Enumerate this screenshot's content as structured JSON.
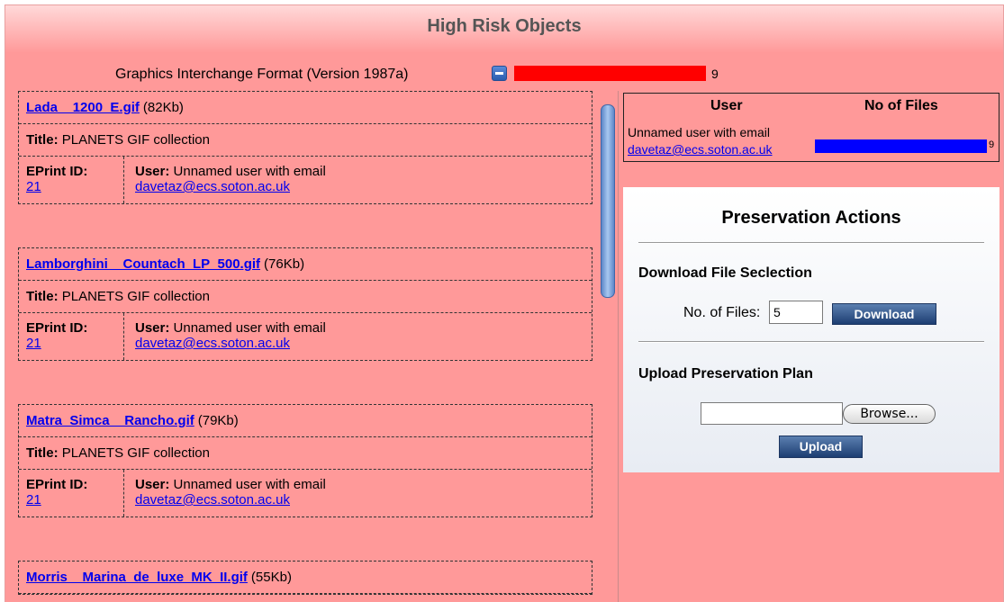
{
  "header": {
    "title": "High Risk Objects"
  },
  "format": {
    "label": "Graphics Interchange Format (Version 1987a)",
    "count": "9",
    "bar_color": "#ff0000"
  },
  "records": [
    {
      "filename": "Lada__1200_E.gif",
      "size": "(82Kb)",
      "title_label": "Title:",
      "title_value": "PLANETS GIF collection",
      "eprint_label": "EPrint ID:",
      "eprint_id": "21",
      "user_label": "User:",
      "user_value": "Unnamed user with email",
      "user_email": "davetaz@ecs.soton.ac.uk"
    },
    {
      "filename": "Lamborghini__Countach_LP_500.gif",
      "size": "(76Kb)",
      "title_label": "Title:",
      "title_value": "PLANETS GIF collection",
      "eprint_label": "EPrint ID:",
      "eprint_id": "21",
      "user_label": "User:",
      "user_value": "Unnamed user with email",
      "user_email": "davetaz@ecs.soton.ac.uk"
    },
    {
      "filename": "Matra_Simca__Rancho.gif",
      "size": "(79Kb)",
      "title_label": "Title:",
      "title_value": "PLANETS GIF collection",
      "eprint_label": "EPrint ID:",
      "eprint_id": "21",
      "user_label": "User:",
      "user_value": "Unnamed user with email",
      "user_email": "davetaz@ecs.soton.ac.uk"
    },
    {
      "filename": "Morris__Marina_de_luxe_MK_II.gif",
      "size": "(55Kb)"
    }
  ],
  "user_table": {
    "col_user": "User",
    "col_files": "No of Files",
    "user_text": "Unnamed user with email",
    "user_email": "davetaz@ecs.soton.ac.uk",
    "count": "9",
    "bar_color": "#0000ff"
  },
  "actions": {
    "title": "Preservation Actions",
    "download_section": "Download File Seclection",
    "nfiles_label": "No. of Files:",
    "nfiles_value": "5",
    "download_button": "Download",
    "upload_section": "Upload Preservation Plan",
    "browse_button": "Browse...",
    "upload_button": "Upload"
  }
}
